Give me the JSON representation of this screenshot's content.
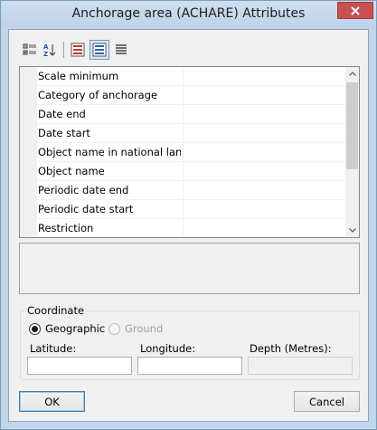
{
  "window": {
    "title": "Anchorage area (ACHARE) Attributes"
  },
  "toolbar": {
    "buttons": [
      {
        "name": "categorized-view",
        "active": false
      },
      {
        "name": "alphabetical-sort",
        "active": false
      },
      {
        "name": "show-attributes",
        "active": false
      },
      {
        "name": "show-acronyms",
        "active": true
      },
      {
        "name": "show-all",
        "active": false
      }
    ]
  },
  "properties": {
    "rows": [
      {
        "label": "Scale minimum",
        "value": ""
      },
      {
        "label": "Category of anchorage",
        "value": ""
      },
      {
        "label": "Date end",
        "value": ""
      },
      {
        "label": "Date start",
        "value": ""
      },
      {
        "label": "Object name in national langu",
        "value": ""
      },
      {
        "label": "Object name",
        "value": ""
      },
      {
        "label": "Periodic date end",
        "value": ""
      },
      {
        "label": "Periodic date start",
        "value": ""
      },
      {
        "label": "Restriction",
        "value": ""
      }
    ],
    "scroll_position": 0.0
  },
  "coordinate": {
    "legend": "Coordinate",
    "geographic_label": "Geographic",
    "ground_label": "Ground",
    "selected": "Geographic",
    "latitude_label": "Latitude:",
    "longitude_label": "Longitude:",
    "depth_label": "Depth (Metres):",
    "latitude_value": "",
    "longitude_value": "",
    "depth_value": ""
  },
  "buttons": {
    "ok": "OK",
    "cancel": "Cancel"
  },
  "colors": {
    "accent": "#3c7fb1",
    "close": "#c75050",
    "title_bar": "#c3d5ea"
  }
}
